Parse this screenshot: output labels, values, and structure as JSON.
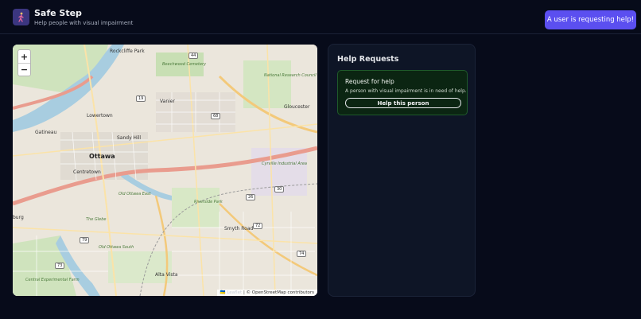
{
  "header": {
    "title": "Safe Step",
    "subtitle": "Help people with visual impairment",
    "logo_icon": "walking-person-icon",
    "alert_button": "A user is requesting help!"
  },
  "map": {
    "zoom_in": "+",
    "zoom_out": "−",
    "attribution_flag": "🇺🇦",
    "attribution_leaflet": "Leaflet",
    "attribution": "| © OpenStreetMap contributors",
    "labels": {
      "rockcliffe_park": "Rockcliffe Park",
      "beechwood": "Beechwood Cemetery",
      "vanier": "Vanier",
      "lowertown": "Lowertown",
      "gatineau": "Gatineau",
      "sandy_hill": "Sandy Hill",
      "ottawa": "Ottawa",
      "centretown": "Centretown",
      "gloucester": "Gloucester",
      "nrc": "National Research Council",
      "cyrville": "Cyrville Industrial Area",
      "glebe": "The Glebe",
      "old_ottawa_south": "Old Ottawa South",
      "alta_vista": "Alta Vista",
      "central_exp_farm": "Central Experimental Farm",
      "burg": "burg",
      "riverside_park": "Riverside Park",
      "smyth": "Smyth Road",
      "old_ottawa_east": "Old Ottawa East"
    },
    "shields": [
      "44",
      "19",
      "68",
      "26",
      "30",
      "72",
      "79",
      "73",
      "74",
      "19"
    ]
  },
  "panel": {
    "title": "Help Requests",
    "requests": [
      {
        "title": "Request for help",
        "description": "A person with visual impairment is in need of help.",
        "button": "Help this person"
      }
    ]
  },
  "colors": {
    "background": "#070b1a",
    "accent": "#5b4ff0",
    "card_bg": "#0b2512",
    "card_border": "#1f5a2a"
  }
}
